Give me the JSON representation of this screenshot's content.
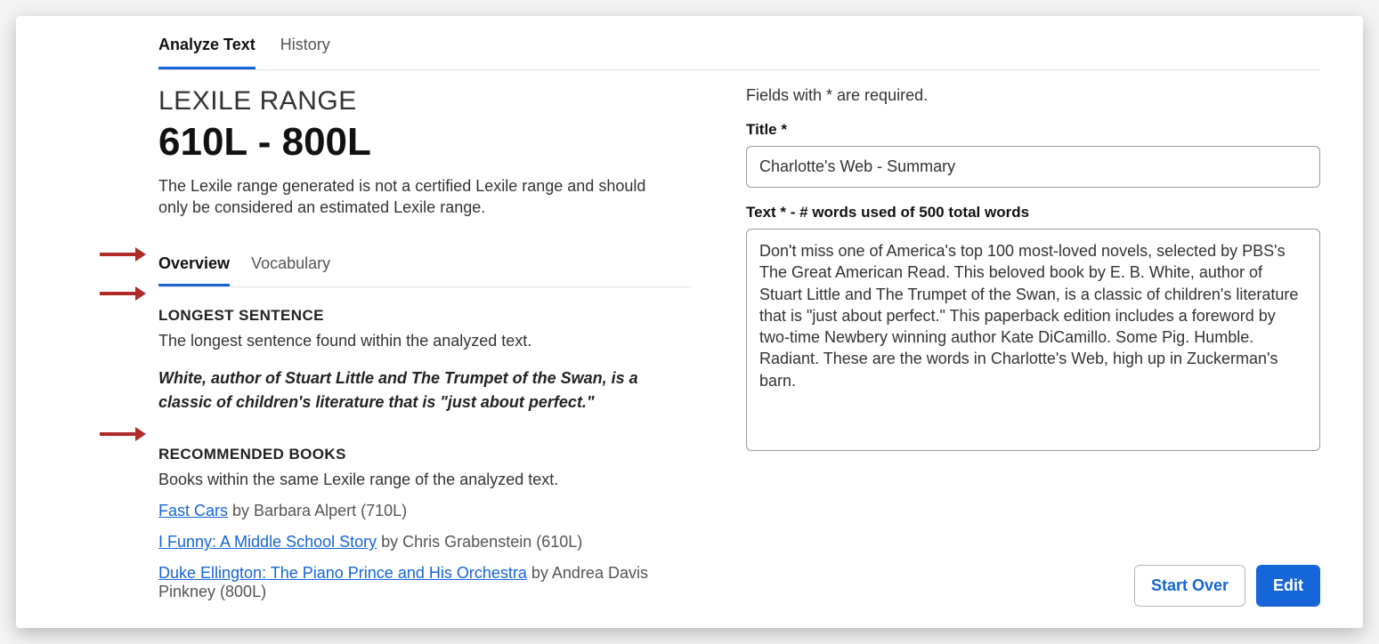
{
  "topTabs": {
    "analyze": "Analyze Text",
    "history": "History"
  },
  "lexile": {
    "label": "LEXILE RANGE",
    "range": "610L - 800L",
    "note": "The Lexile range generated is not a certified Lexile range and should only be considered an estimated Lexile range."
  },
  "subTabs": {
    "overview": "Overview",
    "vocabulary": "Vocabulary"
  },
  "longest": {
    "heading": "LONGEST SENTENCE",
    "sub": "The longest sentence found within the analyzed  text.",
    "sentence": "White, author of Stuart Little and The Trumpet of the Swan, is a classic of children's literature that is \"just about perfect.\""
  },
  "recommended": {
    "heading": "RECOMMENDED BOOKS",
    "sub": "Books within the same Lexile range of the analyzed text.",
    "books": [
      {
        "title": "Fast Cars",
        "rest": " by Barbara Alpert (710L)"
      },
      {
        "title": "I Funny: A Middle School Story",
        "rest": " by Chris Grabenstein (610L)"
      },
      {
        "title": "Duke Ellington: The Piano Prince and His Orchestra",
        "rest": " by Andrea Davis Pinkney (800L)"
      }
    ]
  },
  "form": {
    "requiredNote": "Fields with * are required.",
    "titleLabel": "Title *",
    "titleValue": "Charlotte's Web - Summary",
    "textLabel": "Text * -  # words used of 500 total words",
    "textValue": "Don't miss one of America's top 100 most-loved novels, selected by PBS's The Great American Read. This beloved book by E. B. White, author of Stuart Little and The Trumpet of the Swan, is a classic of children's literature that is \"just about perfect.\" This paperback edition includes a foreword by two-time Newbery winning author Kate DiCamillo. Some Pig. Humble. Radiant. These are the words in Charlotte's Web, high up in Zuckerman's barn."
  },
  "actions": {
    "startOver": "Start Over",
    "edit": "Edit"
  }
}
